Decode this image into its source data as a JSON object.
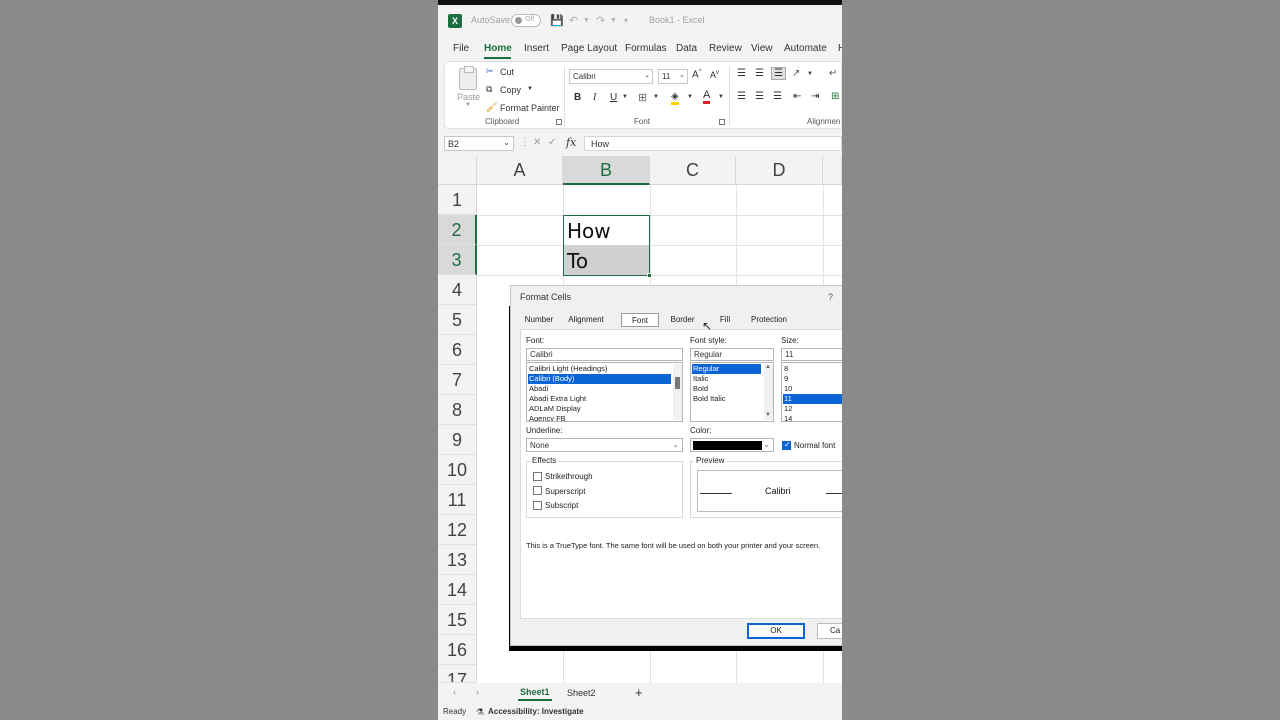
{
  "titlebar": {
    "autosave_label": "AutoSave",
    "autosave_state": "Off",
    "book_title": "Book1  -  Excel"
  },
  "menu": {
    "items": [
      "File",
      "Home",
      "Insert",
      "Page Layout",
      "Formulas",
      "Data",
      "Review",
      "View",
      "Automate",
      "H"
    ],
    "active": "Home"
  },
  "ribbon": {
    "paste_label": "Paste",
    "cut_label": "Cut",
    "copy_label": "Copy",
    "format_painter_label": "Format Painter",
    "clipboard_group": "Clipboard",
    "font_name": "Calibri",
    "font_size": "11",
    "font_group": "Font",
    "alignment_group": "Alignmen",
    "bold": "B",
    "italic": "I",
    "underline": "U",
    "font_color_glyph": "A"
  },
  "formula_bar": {
    "name_box": "B2",
    "fx": "fx",
    "formula": "How"
  },
  "grid": {
    "columns": [
      "A",
      "B",
      "C",
      "D"
    ],
    "selected_column": "B",
    "rows": [
      "1",
      "2",
      "3",
      "4",
      "5",
      "6",
      "7",
      "8",
      "9",
      "10",
      "11",
      "12",
      "13",
      "14",
      "15",
      "16",
      "17"
    ],
    "selected_rows": [
      "2",
      "3"
    ],
    "cells": {
      "B2": "How",
      "B3": "To"
    }
  },
  "dialog": {
    "title": "Format Cells",
    "help": "?",
    "tabs": [
      "Number",
      "Alignment",
      "Font",
      "Border",
      "Fill",
      "Protection"
    ],
    "active_tab": "Font",
    "font_label": "Font:",
    "font_value": "Calibri",
    "font_list": [
      "Calibri Light (Headings)",
      "Calibri (Body)",
      "Abadi",
      "Abadi Extra Light",
      "ADLaM Display",
      "Agency FB"
    ],
    "font_selected": "Calibri (Body)",
    "style_label": "Font style:",
    "style_value": "Regular",
    "style_list": [
      "Regular",
      "Italic",
      "Bold",
      "Bold Italic"
    ],
    "style_selected": "Regular",
    "size_label": "Size:",
    "size_value": "11",
    "size_list": [
      "8",
      "9",
      "10",
      "11",
      "12",
      "14"
    ],
    "size_selected": "11",
    "underline_label": "Underline:",
    "underline_value": "None",
    "color_label": "Color:",
    "color_value": "#000000",
    "normal_font_label": "Normal font",
    "normal_font_checked": true,
    "effects_label": "Effects",
    "strikethrough_label": "Strikethrough",
    "superscript_label": "Superscript",
    "subscript_label": "Subscript",
    "preview_label": "Preview",
    "preview_text": "Calibri",
    "info_text": "This is a TrueType font.  The same font will be used on both your printer and your screen.",
    "ok_label": "OK",
    "cancel_label": "Ca"
  },
  "sheets": {
    "tabs": [
      "Sheet1",
      "Sheet2"
    ],
    "active": "Sheet1",
    "add": "+"
  },
  "status": {
    "ready": "Ready",
    "accessibility": "Accessibility: Investigate"
  },
  "colors": {
    "accent": "#1d6f42",
    "selection_blue": "#0a64d6"
  }
}
